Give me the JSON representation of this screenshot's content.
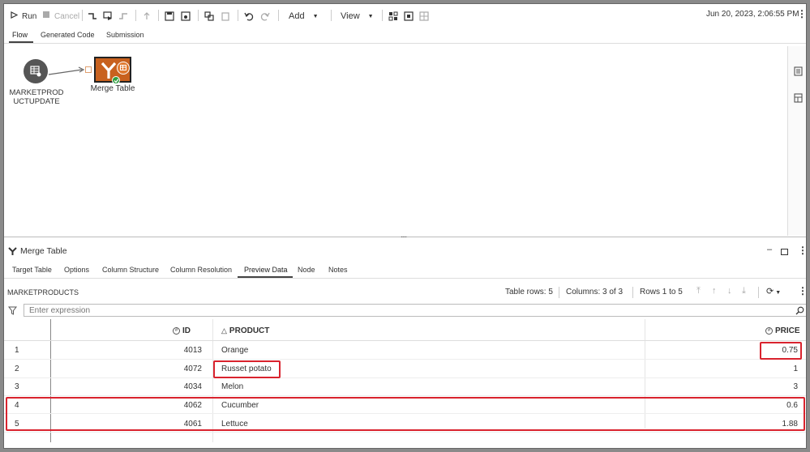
{
  "toolbar": {
    "run_label": "Run",
    "cancel_label": "Cancel",
    "add_label": "Add",
    "view_label": "View",
    "timestamp": "Jun 20, 2023, 2:06:55 PM"
  },
  "tabs": [
    "Flow",
    "Generated Code",
    "Submission"
  ],
  "flow": {
    "source_node_label_line1": "MARKETPROD",
    "source_node_label_line2": "UCTUPDATE",
    "merge_node_label": "Merge Table"
  },
  "splitter_handle": "....",
  "details": {
    "title": "Merge Table",
    "tabs": [
      "Target Table",
      "Options",
      "Column Structure",
      "Column Resolution",
      "Preview Data",
      "Node",
      "Notes"
    ],
    "active_tab": "Preview Data",
    "table_name": "MARKETPRODUCTS",
    "table_rows": "Table rows: 5",
    "columns_info": "Columns: 3 of 3",
    "rows_info": "Rows 1 to 5",
    "filter_placeholder": "Enter expression"
  },
  "grid": {
    "columns": [
      "ID",
      "PRODUCT",
      "PRICE"
    ],
    "rows": [
      {
        "n": "1",
        "id": "4013",
        "product": "Orange",
        "price": "0.75"
      },
      {
        "n": "2",
        "id": "4072",
        "product": "Russet potato",
        "price": "1"
      },
      {
        "n": "3",
        "id": "4034",
        "product": "Melon",
        "price": "3"
      },
      {
        "n": "4",
        "id": "4062",
        "product": "Cucumber",
        "price": "0.6"
      },
      {
        "n": "5",
        "id": "4061",
        "product": "Lettuce",
        "price": "1.88"
      }
    ]
  },
  "colors": {
    "highlight": "#d9232e",
    "merge_node": "#c8611e",
    "source_node": "#555555",
    "status_ok": "#2e9e3e"
  }
}
